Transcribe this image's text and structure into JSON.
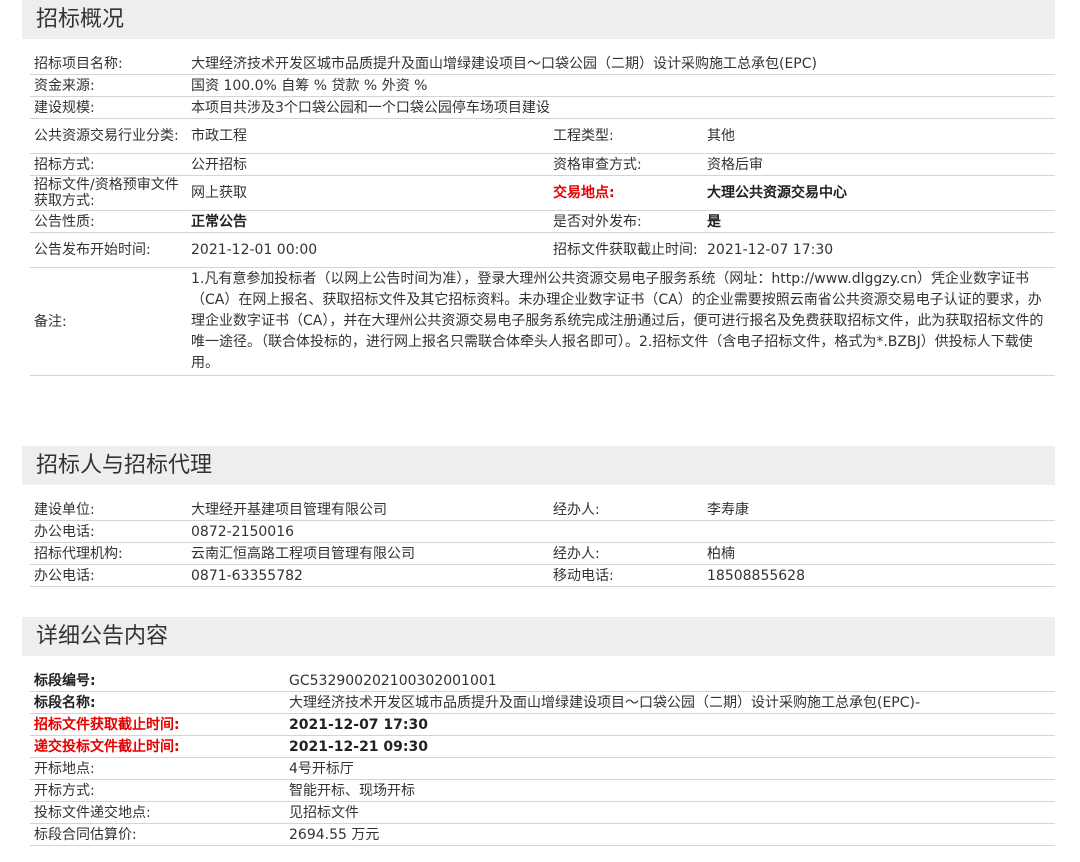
{
  "sections": {
    "overview_title": "招标概况",
    "agent_title": "招标人与招标代理",
    "detail_title": "详细公告内容"
  },
  "overview": {
    "project_name": {
      "label": "招标项目名称:",
      "value": "大理经济技术开发区城市品质提升及面山增绿建设项目～口袋公园（二期）设计采购施工总承包(EPC)"
    },
    "funding": {
      "label": "资金来源:",
      "value": "国资 100.0% 自筹 % 贷款 % 外资 %"
    },
    "scale": {
      "label": "建设规模:",
      "value": "本项目共涉及3个口袋公园和一个口袋公园停车场项目建设"
    },
    "industry": {
      "label": "公共资源交易行业分类:",
      "value": "市政工程"
    },
    "project_type": {
      "label": "工程类型:",
      "value": "其他"
    },
    "method": {
      "label": "招标方式:",
      "value": "公开招标"
    },
    "qualification": {
      "label": "资格审查方式:",
      "value": "资格后审"
    },
    "doc_method": {
      "label": "招标文件/资格预审文件获取方式:",
      "value": "网上获取"
    },
    "venue": {
      "label": "交易地点:",
      "value": "大理公共资源交易中心"
    },
    "nature": {
      "label": "公告性质:",
      "value": "正常公告"
    },
    "public": {
      "label": "是否对外发布:",
      "value": "是"
    },
    "start_time": {
      "label": "公告发布开始时间:",
      "value": "2021-12-01 00:00"
    },
    "doc_deadline": {
      "label": "招标文件获取截止时间:",
      "value": "2021-12-07 17:30"
    },
    "note": {
      "label": "备注:",
      "value": "1.凡有意参加投标者（以网上公告时间为准），登录大理州公共资源交易电子服务系统（网址：http://www.dlggzy.cn）凭企业数字证书（CA）在网上报名、获取招标文件及其它招标资料。未办理企业数字证书（CA）的企业需要按照云南省公共资源交易电子认证的要求，办理企业数字证书（CA），并在大理州公共资源交易电子服务系统完成注册通过后，便可进行报名及免费获取招标文件，此为获取招标文件的唯一途径。（联合体投标的，进行网上报名只需联合体牵头人报名即可）。2.招标文件（含电子招标文件，格式为*.BZBJ）供投标人下载使用。"
    }
  },
  "agent": {
    "owner": {
      "label": "建设单位:",
      "value": "大理经开基建项目管理有限公司"
    },
    "owner_contact": {
      "label": "经办人:",
      "value": "李寿康"
    },
    "owner_phone": {
      "label": "办公电话:",
      "value": "0872-2150016"
    },
    "agency": {
      "label": "招标代理机构:",
      "value": "云南汇恒高路工程项目管理有限公司"
    },
    "agency_contact": {
      "label": "经办人:",
      "value": "柏楠"
    },
    "agency_phone": {
      "label": "办公电话:",
      "value": "0871-63355782"
    },
    "agency_mobile": {
      "label": "移动电话:",
      "value": "18508855628"
    }
  },
  "detail": {
    "rows": [
      {
        "label": "标段编号:",
        "value": "GC5329002021003020010 01",
        "style": "bold"
      },
      {
        "label": "标段名称:",
        "value": "大理经济技术开发区城市品质提升及面山增绿建设项目～口袋公园（二期）设计采购施工总承包(EPC)-",
        "style": "bold"
      },
      {
        "label": "招标文件获取截止时间:",
        "value": "2021-12-07 17:30",
        "style": "red"
      },
      {
        "label": "递交投标文件截止时间:",
        "value": "2021-12-21 09:30",
        "style": "red"
      },
      {
        "label": "开标地点:",
        "value": "4号开标厅",
        "style": "normal"
      },
      {
        "label": "开标方式:",
        "value": "智能开标、现场开标",
        "style": "normal"
      },
      {
        "label": "投标文件递交地点:",
        "value": "见招标文件",
        "style": "normal"
      },
      {
        "label": "标段合同估算价:",
        "value": "2694.55 万元",
        "style": "normal"
      }
    ]
  }
}
